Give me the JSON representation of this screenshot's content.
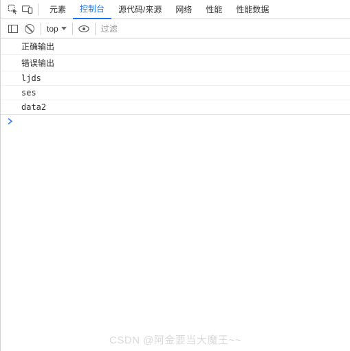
{
  "tabs": {
    "items": [
      "元素",
      "控制台",
      "源代码/来源",
      "网络",
      "性能",
      "性能数据"
    ],
    "activeIndex": 1
  },
  "toolbar": {
    "context": "top",
    "filter_placeholder": "过滤"
  },
  "console": {
    "lines": [
      "正确输出",
      "错误输出",
      "ljds",
      "ses",
      "data2"
    ]
  },
  "watermark": "CSDN @阿金要当大魔王~~"
}
